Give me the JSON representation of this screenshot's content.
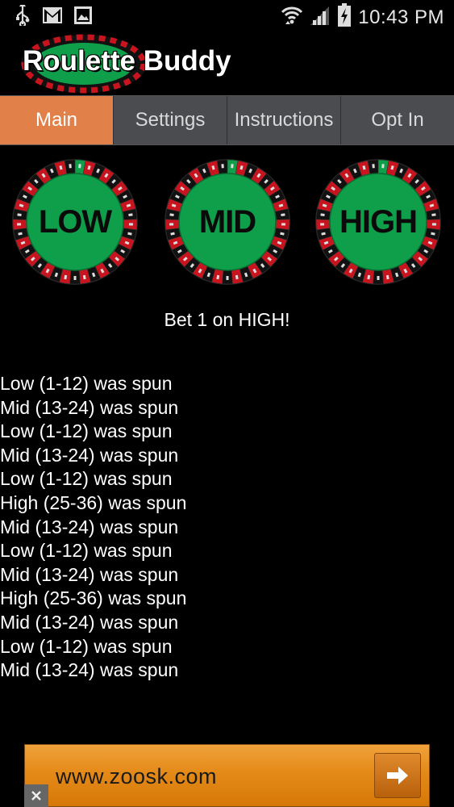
{
  "status_bar": {
    "time": "10:43 PM",
    "left_icons": [
      "usb-icon",
      "gmail-icon",
      "gallery-icon"
    ],
    "right_icons": [
      "wifi-icon",
      "signal-icon",
      "battery-charging-icon"
    ]
  },
  "app": {
    "title": "Roulette Buddy"
  },
  "tabs": [
    {
      "label": "Main",
      "active": true
    },
    {
      "label": "Settings",
      "active": false
    },
    {
      "label": "Instructions",
      "active": false
    },
    {
      "label": "Opt In",
      "active": false
    }
  ],
  "wheels": [
    {
      "label": "LOW"
    },
    {
      "label": "MID"
    },
    {
      "label": "HIGH"
    }
  ],
  "bet_message": "Bet 1 on HIGH!",
  "history": [
    "Low (1-12) was spun",
    "Mid (13-24) was spun",
    "Low (1-12) was spun",
    "Mid (13-24) was spun",
    "Low (1-12) was spun",
    "High (25-36) was spun",
    "Mid (13-24) was spun",
    "Low (1-12) was spun",
    "Mid (13-24) was spun",
    "High (25-36) was spun",
    "Mid (13-24) was spun",
    "Low (1-12) was spun",
    "Mid (13-24) was spun"
  ],
  "ad": {
    "text": "www.zoosk.com",
    "arrow_icon": "arrow-right-icon",
    "close_icon": "close-icon"
  },
  "colors": {
    "accent_tab": "#e2804a",
    "tab_bg": "#4a4c50",
    "felt_green": "#0f9e4a",
    "wheel_red": "#c8141e",
    "ad_orange": "#e48a18"
  }
}
